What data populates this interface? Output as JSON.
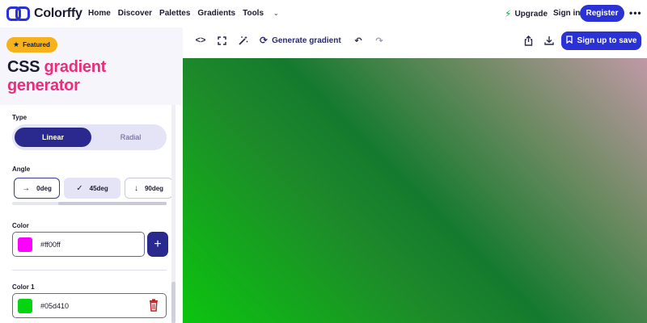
{
  "app": {
    "name": "Colorffy"
  },
  "nav": {
    "links": [
      "Home",
      "Discover",
      "Palettes",
      "Gradients",
      "Tools"
    ],
    "upgrade": "Upgrade",
    "signin": "Sign in",
    "register": "Register"
  },
  "hero": {
    "badge": "Featured",
    "title_part1": "CSS",
    "title_part2": "gradient",
    "title_part3": "generator"
  },
  "controls": {
    "type_label": "Type",
    "type_options": [
      "Linear",
      "Radial"
    ],
    "type_selected": "Linear",
    "angle_label": "Angle",
    "angles": [
      "0deg",
      "45deg",
      "90deg"
    ],
    "angle_selected": "45deg",
    "color_label": "Color",
    "color_value": "#ff00ff",
    "color1_label": "Color 1",
    "color1_value": "#05d410"
  },
  "toolbar": {
    "generate": "Generate gradient",
    "signup": "Sign up to save"
  },
  "colors": {
    "accent": "#2a32d6",
    "dark_accent": "#2a2a8e",
    "brand_pink": "#ea2e7c",
    "featured": "#f6b21b",
    "swatch_magenta": "#ff00ff",
    "swatch_green": "#05d410"
  }
}
